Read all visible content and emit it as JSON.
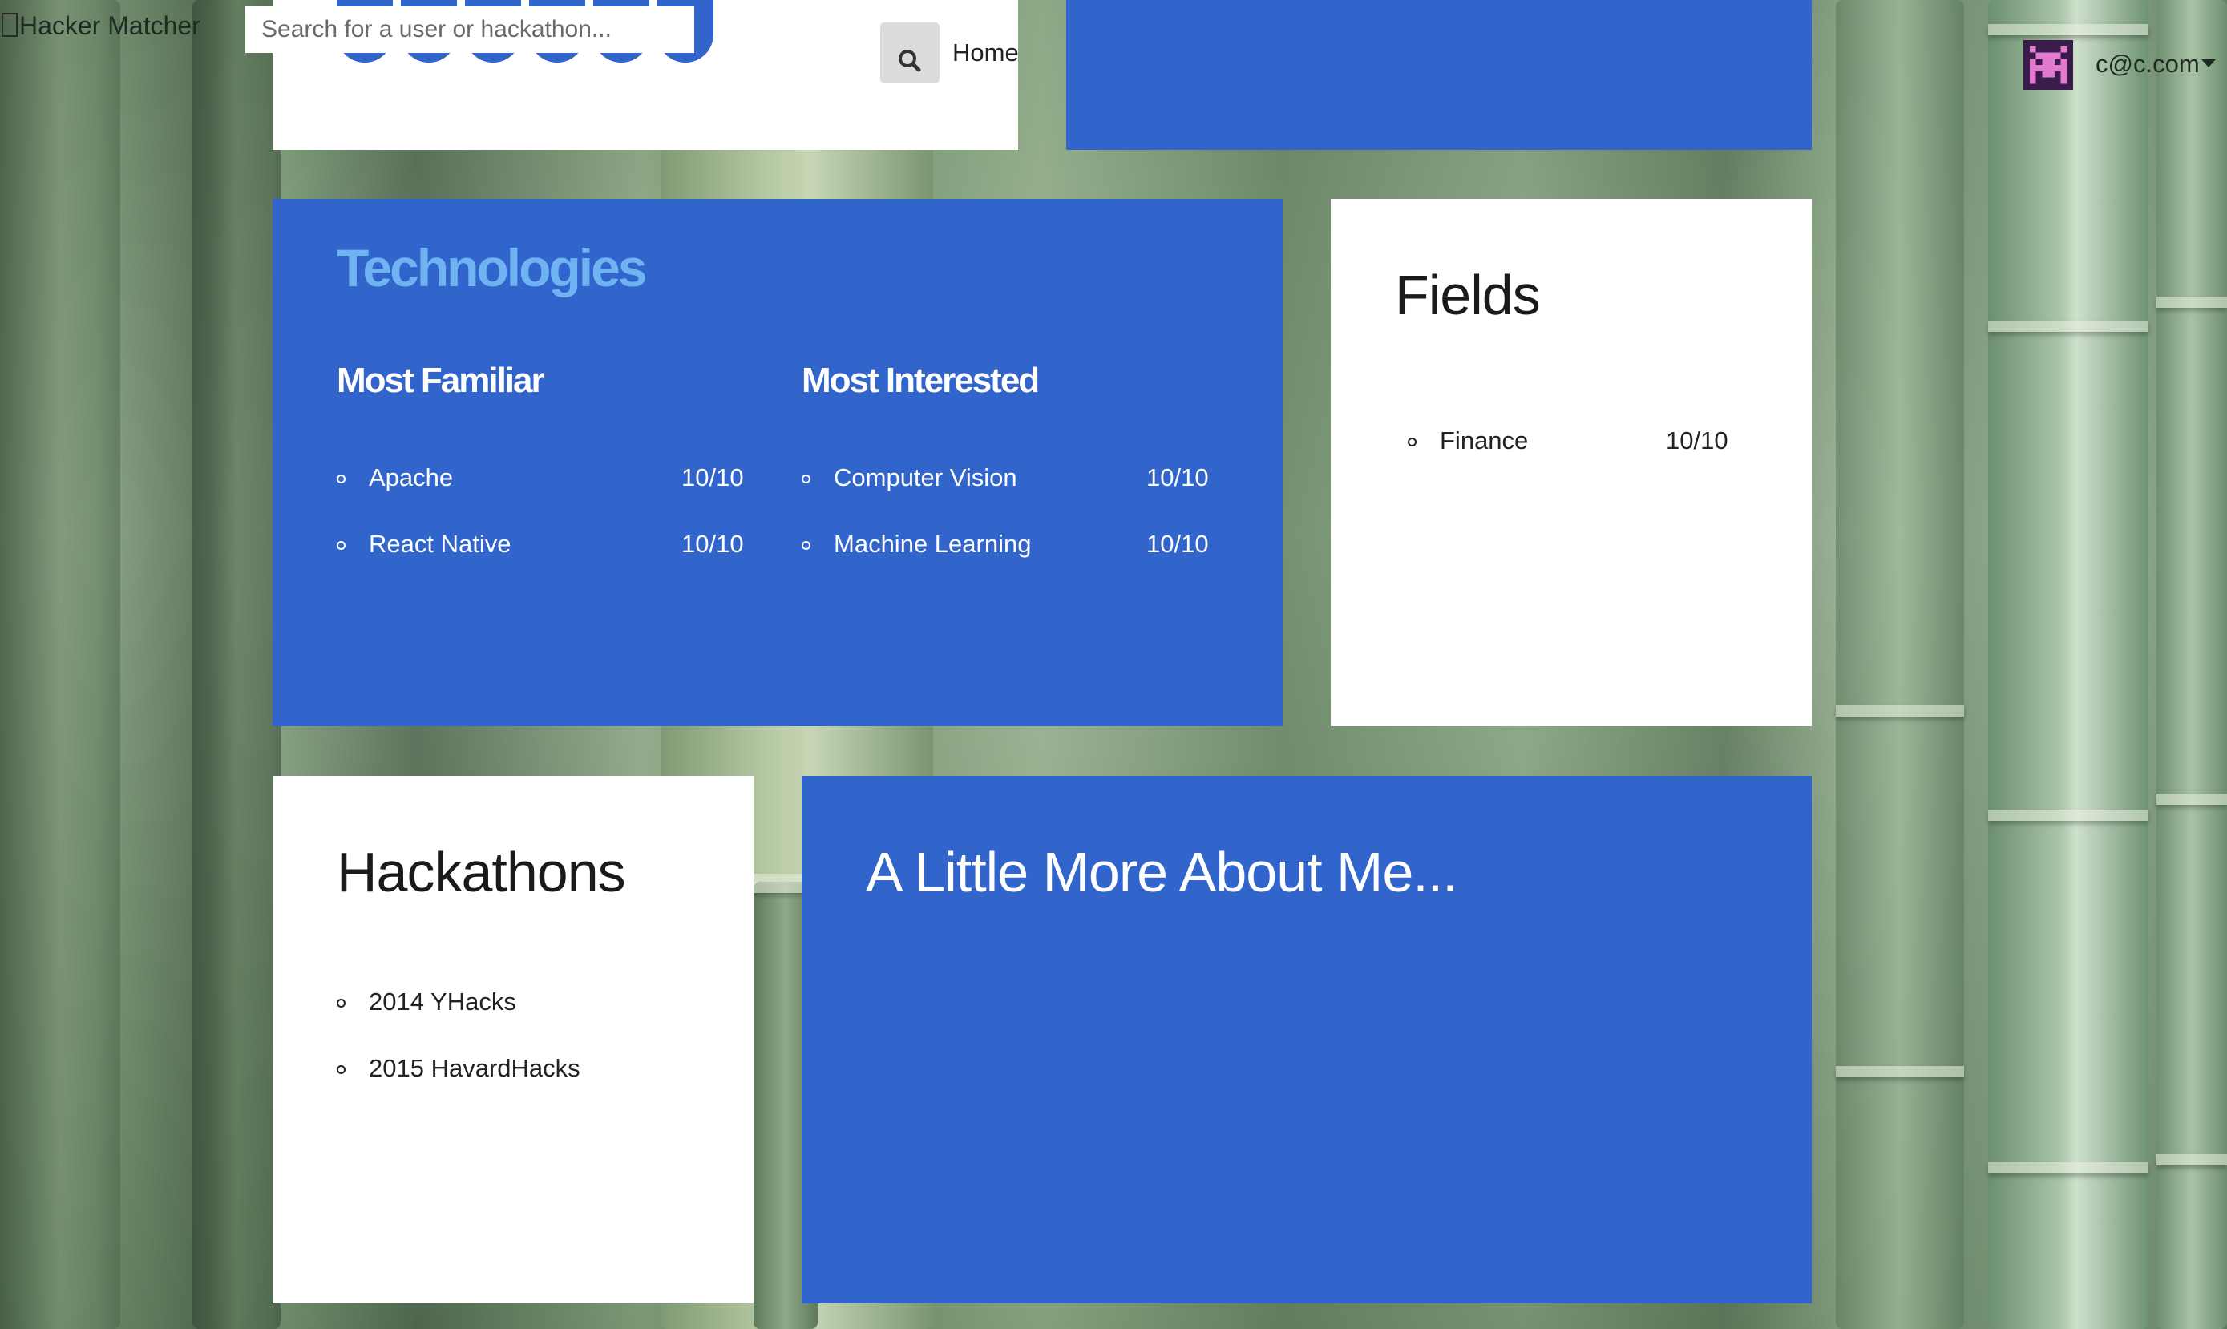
{
  "nav": {
    "brand": "Hacker Matcher",
    "search_placeholder": "Search for a user or hackathon...",
    "search_icon": "search-icon",
    "home_link": "Home",
    "user_email": "c@c.com",
    "user_avatar": "pixel-avatar-icon"
  },
  "colors": {
    "card_blue": "#3165cc",
    "title_light_blue": "#6fb3f2",
    "card_white": "#ffffff"
  },
  "technologies": {
    "title": "Technologies",
    "most_familiar": {
      "heading": "Most Familiar",
      "items": [
        {
          "name": "Apache",
          "score": "10/10"
        },
        {
          "name": "React Native",
          "score": "10/10"
        }
      ]
    },
    "most_interested": {
      "heading": "Most Interested",
      "items": [
        {
          "name": "Computer Vision",
          "score": "10/10"
        },
        {
          "name": "Machine Learning",
          "score": "10/10"
        }
      ]
    }
  },
  "fields": {
    "title": "Fields",
    "items": [
      {
        "name": "Finance",
        "score": "10/10"
      }
    ]
  },
  "hackathons": {
    "title": "Hackathons",
    "items": [
      "2014 YHacks",
      "2015 HavardHacks"
    ]
  },
  "about": {
    "title": "A Little More About Me..."
  }
}
